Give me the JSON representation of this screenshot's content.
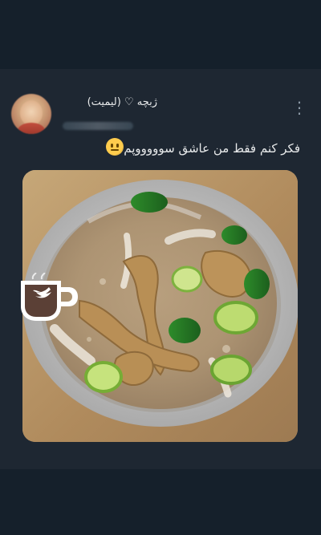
{
  "tweet": {
    "display_name": "ژبچه ♡ (لیمیت)",
    "text": "فکر کنم فقط من عاشق سوووووپم",
    "emoji_icon": "neutral-face-emoji",
    "more_icon": "more-vertical-icon"
  },
  "media": {
    "type": "photo",
    "subject_icon": "soup-bowl-photo"
  },
  "overlay": {
    "icon": "twitter-coffee-cup-icon"
  },
  "colors": {
    "background": "#15202b",
    "card": "#1e2732",
    "text": "#e7e9ea",
    "muted": "#8b98a5"
  }
}
